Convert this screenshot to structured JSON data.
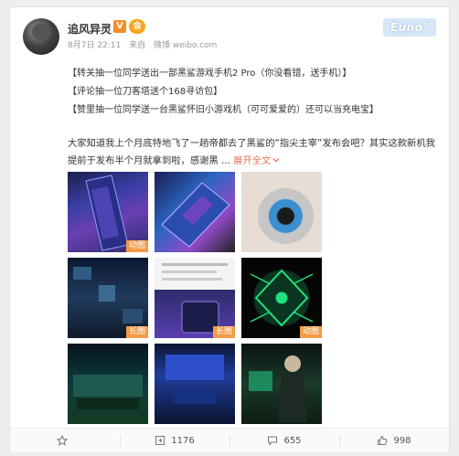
{
  "post": {
    "username": "追风异灵",
    "verified_badge": "V",
    "member_badge": "会",
    "brand_logo": "Euno°",
    "meta": {
      "date": "8月7日 22:11",
      "from_label": "来自",
      "source": "微博 weibo.com"
    },
    "lines": [
      "【转关抽一位同学送出一部黑鲨游戏手机2 Pro（你没看错，送手机）】",
      "【评论抽一位刀客塔送个168寻访包】",
      "【赞里抽一位同学送一台黑鲨怀旧小游戏机（可可爱爱的）还可以当充电宝】"
    ],
    "body": "大家知道我上个月底特地飞了一趟帝都去了黑鲨的“指尖主宰”发布会吧？其实这款新机我提前于发布半个月就拿到啦，感谢黑 ...",
    "expand_label": "展开全文",
    "expand_icon": "chevron-down-icon",
    "image_tags": {
      "t1": "动图",
      "t4": "长图",
      "t5": "长图",
      "t6": "动图"
    }
  },
  "actions": {
    "collect": {
      "icon": "star-icon",
      "label": ""
    },
    "repost": {
      "icon": "repost-icon",
      "count": "1176"
    },
    "comment": {
      "icon": "comment-icon",
      "count": "655"
    },
    "like": {
      "icon": "thumbs-up-icon",
      "count": "998"
    }
  },
  "colors": {
    "accent": "#eb7350",
    "tag_bg": "#f29b47",
    "verified": "#f28c28"
  }
}
